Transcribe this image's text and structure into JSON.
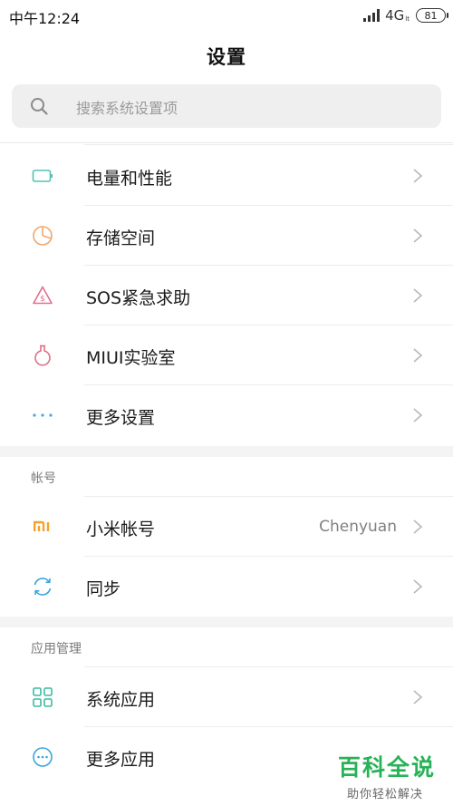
{
  "status_bar": {
    "time": "中午12:24",
    "network": "4G",
    "network_sub": "lt",
    "battery": "81"
  },
  "header": {
    "title": "设置"
  },
  "search": {
    "placeholder": "搜索系统设置项"
  },
  "rows": [
    {
      "label": "电量和性能",
      "icon": "battery-icon",
      "color": "#4fc3b6"
    },
    {
      "label": "存储空间",
      "icon": "pie-chart-icon",
      "color": "#f2a66b"
    },
    {
      "label": "SOS紧急求助",
      "icon": "sos-warning-icon",
      "color": "#e0708a"
    },
    {
      "label": "MIUI实验室",
      "icon": "flask-icon",
      "color": "#e06f85"
    },
    {
      "label": "更多设置",
      "icon": "more-dots-icon",
      "color": "#46a7e0"
    }
  ],
  "account_section": {
    "header": "帐号",
    "rows": [
      {
        "label": "小米帐号",
        "value": "Chenyuan",
        "icon": "mi-logo-icon",
        "color": "#f5a22f"
      },
      {
        "label": "同步",
        "icon": "sync-icon",
        "color": "#3aa4df"
      }
    ]
  },
  "apps_section": {
    "header": "应用管理",
    "rows": [
      {
        "label": "系统应用",
        "icon": "apps-grid-icon",
        "color": "#3dbba0"
      },
      {
        "label": "更多应用",
        "icon": "more-apps-icon",
        "color": "#3aa4df"
      }
    ]
  },
  "watermark": {
    "main": "百科全说",
    "sub": "助你轻松解决"
  }
}
